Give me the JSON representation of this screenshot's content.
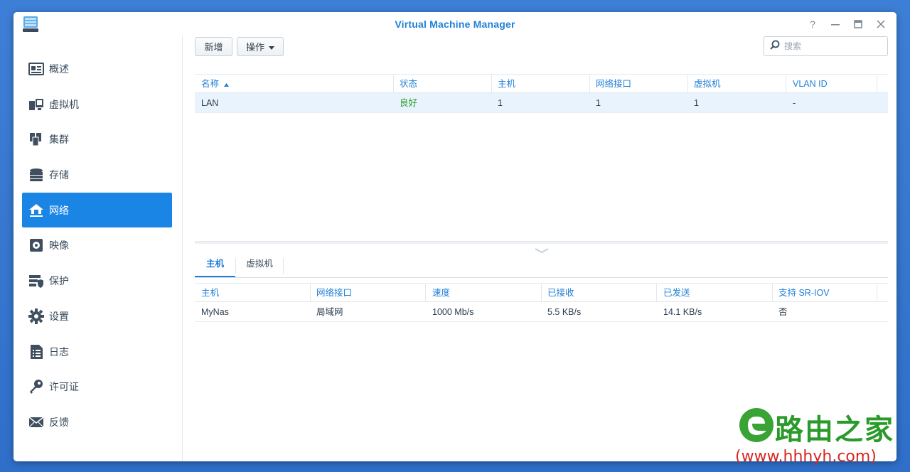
{
  "window": {
    "title": "Virtual Machine Manager"
  },
  "sidebar": {
    "items": [
      {
        "label": "概述",
        "icon": "overview-icon"
      },
      {
        "label": "虚拟机",
        "icon": "virtual-machine-icon"
      },
      {
        "label": "集群",
        "icon": "cluster-icon"
      },
      {
        "label": "存储",
        "icon": "storage-icon"
      },
      {
        "label": "网络",
        "icon": "network-icon",
        "active": true
      },
      {
        "label": "映像",
        "icon": "image-icon"
      },
      {
        "label": "保护",
        "icon": "protection-icon"
      },
      {
        "label": "设置",
        "icon": "settings-gear-icon"
      },
      {
        "label": "日志",
        "icon": "log-icon"
      },
      {
        "label": "许可证",
        "icon": "license-key-icon"
      },
      {
        "label": "反馈",
        "icon": "feedback-mail-icon"
      }
    ]
  },
  "toolbar": {
    "add_label": "新增",
    "action_label": "操作",
    "search_placeholder": "搜索"
  },
  "network_table": {
    "headers": [
      "名称",
      "状态",
      "主机",
      "网络接口",
      "虚拟机",
      "VLAN ID"
    ],
    "rows": [
      {
        "name": "LAN",
        "status": "良好",
        "host": "1",
        "interface": "1",
        "vm": "1",
        "vlan": "-"
      }
    ]
  },
  "detail_tabs": [
    "主机",
    "虚拟机"
  ],
  "host_table": {
    "headers": [
      "主机",
      "网络接口",
      "速度",
      "已接收",
      "已发送",
      "支持 SR-IOV"
    ],
    "rows": [
      {
        "host": "MyNas",
        "interface": "局域网",
        "speed": "1000 Mb/s",
        "received": "5.5 KB/s",
        "sent": "14.1 KB/s",
        "sriov": "否"
      }
    ]
  },
  "watermark": {
    "brand": "路由之家",
    "url": "(www.hhhyh.com)"
  },
  "colors": {
    "accent": "#1a85e5",
    "status_good": "#2ca02c",
    "title": "#1f7fd6"
  }
}
